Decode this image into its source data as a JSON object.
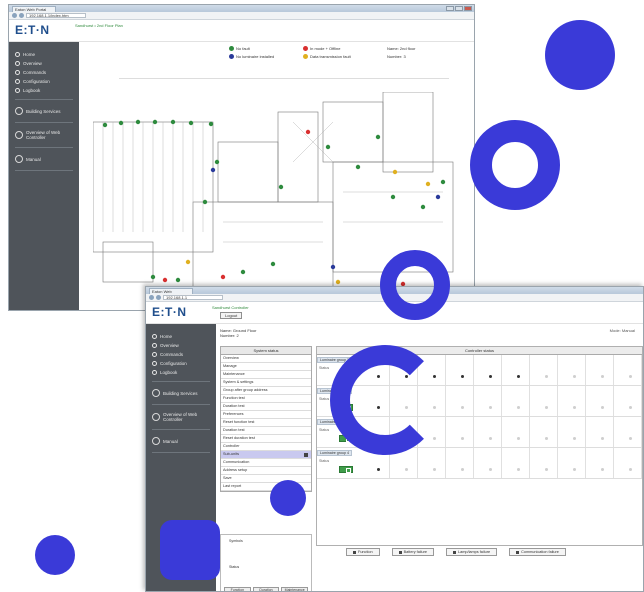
{
  "window1": {
    "tab_title": "Eaton Web Portal",
    "url": "192.168.1.1/index.htm",
    "logo": "E:T·N",
    "system_info": "Sandhurst • 2nd Floor Plan",
    "sidebar_items": [
      {
        "label": "Home",
        "icon": "home-icon"
      },
      {
        "label": "Overview",
        "icon": "overview-icon"
      },
      {
        "label": "Commands",
        "icon": "commands-icon"
      },
      {
        "label": "Configuration",
        "icon": "config-icon"
      },
      {
        "label": "Logbook",
        "icon": "logbook-icon"
      }
    ],
    "sidebar_groups": [
      {
        "label": "Building Services",
        "icon": "building-icon"
      },
      {
        "label": "Overview of Web Controller",
        "icon": "controller-icon"
      },
      {
        "label": "Manual",
        "icon": "manual-icon"
      }
    ],
    "legend": [
      {
        "label": "No fault",
        "color": "#2e8b3e"
      },
      {
        "label": "In mode + Offline",
        "color": "#d93030"
      },
      {
        "label": "Name: 2nd floor",
        "color": ""
      },
      {
        "label": "No luminaire installed",
        "color": "#2a3a9a"
      },
      {
        "label": "Data transmission fault",
        "color": "#e0b020"
      },
      {
        "label": "Number: 3",
        "color": ""
      }
    ]
  },
  "window2": {
    "tab_title": "Eaton Web",
    "url": "192.168.1.1",
    "logo": "E:T·N",
    "system_info": "Sandhurst Controller",
    "logout_label": "Logout",
    "info_name": "Name: Ground Floor",
    "info_number": "Number: 2",
    "mode": "Mode: Manual",
    "system_header": "System status",
    "controller_header": "Controller status",
    "system_rows": [
      {
        "label": "Overview",
        "sel": false
      },
      {
        "label": "Manage",
        "sel": false
      },
      {
        "label": "Maintenance",
        "sel": false
      },
      {
        "label": "System & settings",
        "sel": false
      },
      {
        "label": "Group after group address",
        "sel": false
      },
      {
        "label": "Function test",
        "sel": false
      },
      {
        "label": "Duration test",
        "sel": false
      },
      {
        "label": "Preferences",
        "sel": false
      },
      {
        "label": "Reset function test",
        "sel": false
      },
      {
        "label": "Duration test",
        "sel": false
      },
      {
        "label": "Reset duration test",
        "sel": false
      },
      {
        "label": "Controller",
        "sel": false
      },
      {
        "label": "Sub-units",
        "sel": true
      },
      {
        "label": "Communication",
        "sel": false
      },
      {
        "label": "Address setup",
        "sel": false
      },
      {
        "label": "Save",
        "sel": false
      },
      {
        "label": "Last report",
        "sel": false
      }
    ],
    "controller_rows": [
      {
        "tag": "Luminaire group 1",
        "sub": "Status"
      },
      {
        "tag": "Luminaire group 2",
        "sub": "Status"
      },
      {
        "tag": "Luminaire group 3",
        "sub": "Status"
      },
      {
        "tag": "Luminaire group 4",
        "sub": "Status"
      }
    ],
    "filters": [
      "Function",
      "Battery failure",
      "Lamp/lamps failure",
      "Communication failure"
    ],
    "legend_title": "Symbols",
    "legend_sub": "Status",
    "legend_buttons": [
      "Function",
      "Duration",
      "Maintenance"
    ]
  }
}
